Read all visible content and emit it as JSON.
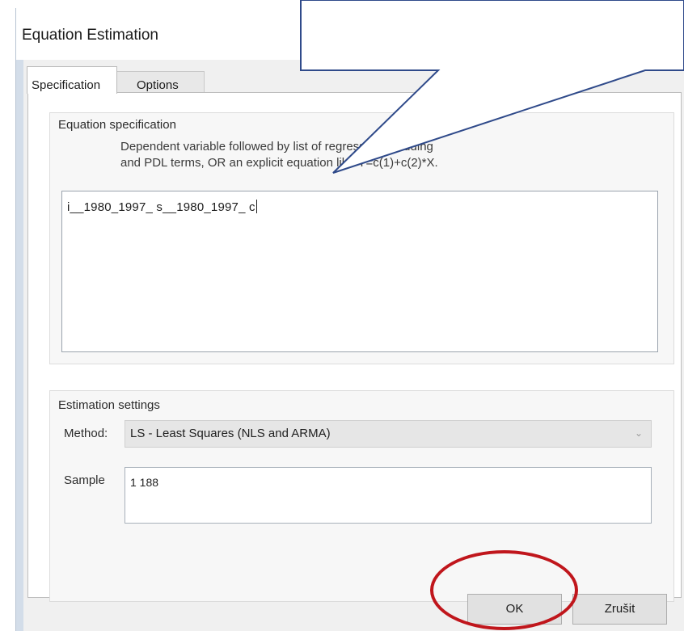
{
  "window": {
    "title": "Equation Estimation"
  },
  "tabs": [
    {
      "label": "Specification",
      "active": true
    },
    {
      "label": "Options",
      "active": false
    }
  ],
  "equation_spec": {
    "group_label": "Equation specification",
    "help_line_1": "Dependent variable followed by list of regressors including",
    "help_line_2": "and PDL terms, OR an explicit equation like Y=c(1)+c(2)*X.",
    "value": "i__1980_1997_ s__1980_1997_ c"
  },
  "estimation_settings": {
    "group_label": "Estimation settings",
    "method_label": "Method:",
    "method_value": "LS  -  Least Squares (NLS and ARMA)",
    "method_dropdown_icon": "chevron-down-icon",
    "sample_label": "Sample",
    "sample_value": "1 188"
  },
  "buttons": {
    "ok": "OK",
    "cancel": "Zrušit"
  },
  "annotations": {
    "callout_color": "#2f4a8a",
    "highlight_color": "#c0161c"
  }
}
